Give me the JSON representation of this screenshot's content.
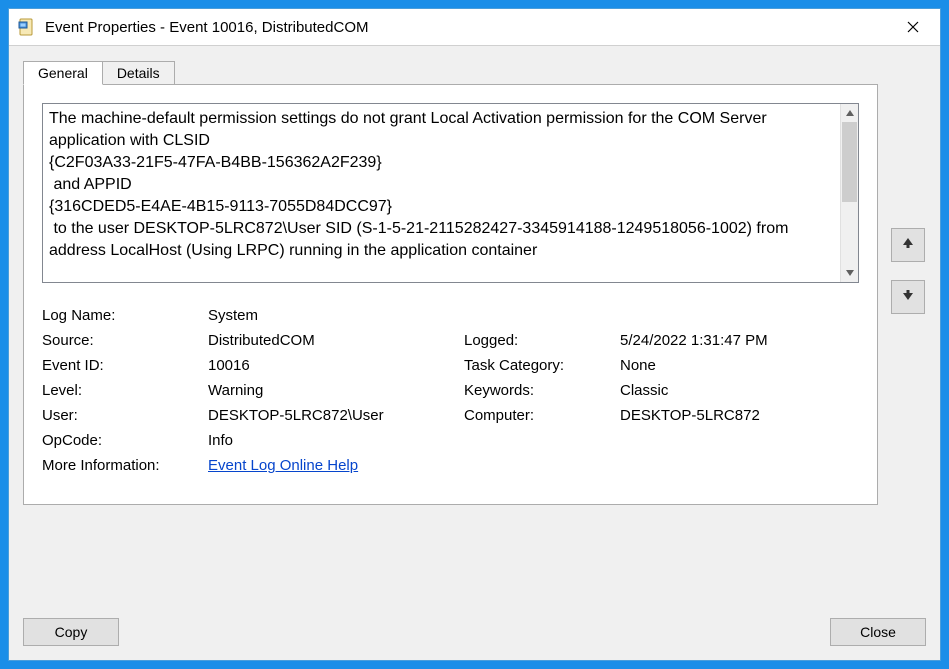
{
  "window": {
    "title": "Event Properties - Event 10016, DistributedCOM"
  },
  "tabs": {
    "general": "General",
    "details": "Details"
  },
  "description": "The machine-default permission settings do not grant Local Activation permission for the COM Server application with CLSID\n{C2F03A33-21F5-47FA-B4BB-156362A2F239}\n and APPID\n{316CDED5-E4AE-4B15-9113-7055D84DCC97}\n to the user DESKTOP-5LRC872\\User SID (S-1-5-21-2115282427-3345914188-1249518056-1002) from address LocalHost (Using LRPC) running in the application container",
  "labels": {
    "logName": "Log Name:",
    "source": "Source:",
    "eventId": "Event ID:",
    "level": "Level:",
    "user": "User:",
    "opcode": "OpCode:",
    "moreInfo": "More Information:",
    "logged": "Logged:",
    "taskCategory": "Task Category:",
    "keywords": "Keywords:",
    "computer": "Computer:"
  },
  "values": {
    "logName": "System",
    "source": "DistributedCOM",
    "eventId": "10016",
    "level": "Warning",
    "user": "DESKTOP-5LRC872\\User",
    "opcode": "Info",
    "logged": "5/24/2022 1:31:47 PM",
    "taskCategory": "None",
    "keywords": "Classic",
    "computer": "DESKTOP-5LRC872"
  },
  "links": {
    "moreInfo": "Event Log Online Help"
  },
  "buttons": {
    "copy": "Copy",
    "close": "Close"
  }
}
